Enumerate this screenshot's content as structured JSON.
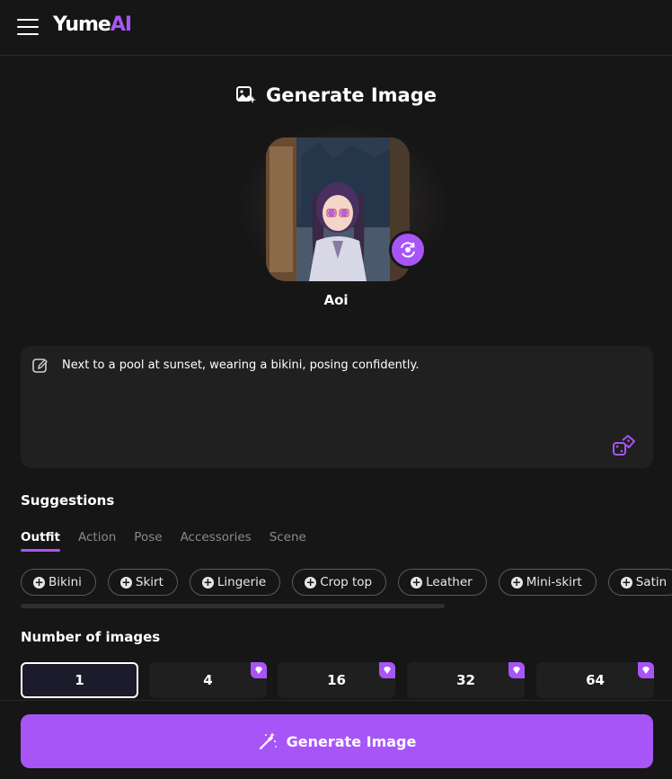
{
  "header": {
    "logo_main": "Yume",
    "logo_accent": "AI",
    "menu_icon": "hamburger-menu-icon"
  },
  "page": {
    "title": "Generate Image",
    "title_icon": "image-sparkle-icon"
  },
  "character": {
    "name": "Aoi",
    "swap_icon": "swap-character-icon"
  },
  "prompt": {
    "text": "Next to a pool at sunset, wearing a bikini, posing confidently.",
    "edit_icon": "edit-pen-icon",
    "random_icon": "dice-icon"
  },
  "suggestions": {
    "title": "Suggestions",
    "tabs": [
      "Outfit",
      "Action",
      "Pose",
      "Accessories",
      "Scene"
    ],
    "active_tab": "Outfit",
    "chips": [
      "Bikini",
      "Skirt",
      "Lingerie",
      "Crop top",
      "Leather",
      "Mini-skirt",
      "Satin"
    ]
  },
  "image_count": {
    "title": "Number of images",
    "options": [
      "1",
      "4",
      "16",
      "32",
      "64"
    ],
    "selected": "1",
    "premium_icon": "gem-icon"
  },
  "generate_button": {
    "label": "Generate Image",
    "icon": "magic-wand-icon"
  },
  "colors": {
    "accent": "#a855f7",
    "background": "#161616",
    "panel": "#202020"
  }
}
